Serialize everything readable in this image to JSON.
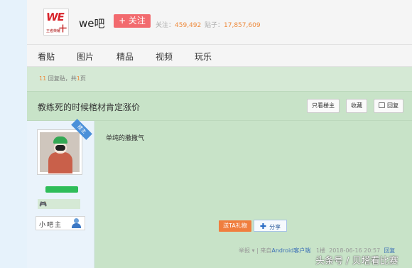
{
  "header": {
    "logo_text": "WE",
    "logo_sub": "王者荣耀",
    "logo_mark": "十",
    "bar_name": "we吧",
    "follow_label": "+ 关注",
    "follow_count_label": "关注：",
    "follow_count": "459,492",
    "post_count_label": "贴子：",
    "post_count": "17,857,609"
  },
  "nav": {
    "items": [
      {
        "label": "看贴"
      },
      {
        "label": "图片"
      },
      {
        "label": "精品"
      },
      {
        "label": "视频"
      },
      {
        "label": "玩乐"
      }
    ]
  },
  "reply_info": {
    "count": "11",
    "count_suffix": " 回复贴，共",
    "pages": "1",
    "pages_suffix": "页"
  },
  "thread": {
    "title": "教练死的时候棺材肯定涨价",
    "buttons": {
      "only_op": "只看楼主",
      "favorite": "收藏",
      "reply": "回复"
    }
  },
  "author": {
    "ribbon": "楼主",
    "role": "小吧主"
  },
  "post": {
    "text": "单纯的撒撒气",
    "gift_label": "送TA礼物",
    "share_label": "分享",
    "meta": {
      "report": "举报",
      "source_prefix": "| 来自",
      "source_link": "Android客户端",
      "floor": "1楼",
      "time": "2018-06-16 20:57",
      "reply": "回复"
    }
  },
  "watermark": "头条号 / 贝塔看比赛",
  "colors": {
    "follow_button": "#f26a6e",
    "accent_orange": "#ee8a3c",
    "post_bg": "#c8e3c8",
    "link_blue": "#3b6fb6"
  }
}
